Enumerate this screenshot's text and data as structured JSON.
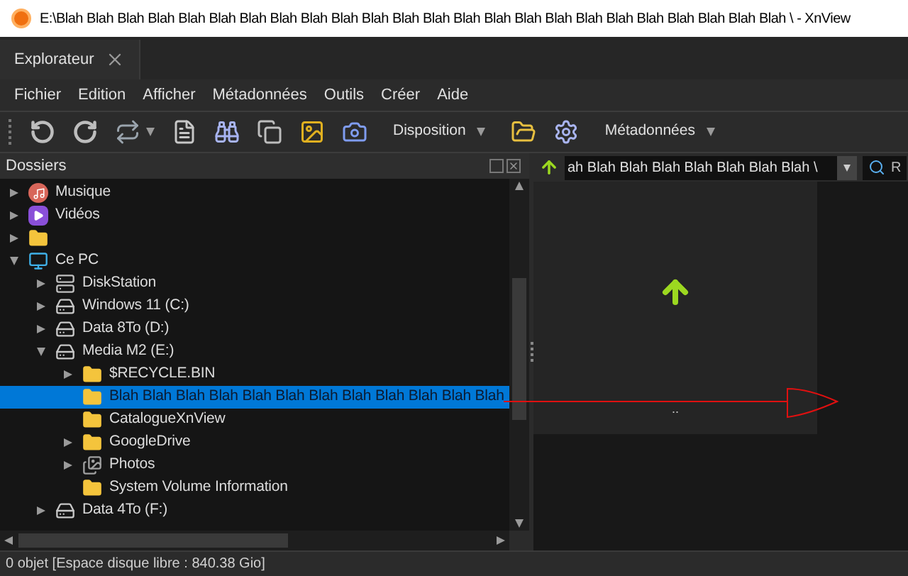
{
  "window": {
    "title": "E:\\Blah Blah Blah Blah Blah Blah Blah Blah Blah Blah Blah Blah Blah Blah Blah Blah Blah Blah Blah Blah Blah Blah Blah Blah \\ - XnView"
  },
  "tabs": [
    {
      "label": "Explorateur",
      "selected": true
    }
  ],
  "menu": [
    "Fichier",
    "Edition",
    "Afficher",
    "Métadonnées",
    "Outils",
    "Créer",
    "Aide"
  ],
  "toolbar": [
    {
      "kind": "rotate-left"
    },
    {
      "kind": "rotate-right"
    },
    {
      "kind": "transform"
    },
    {
      "kind": "info"
    },
    {
      "kind": "binoculars"
    },
    {
      "kind": "convert"
    },
    {
      "kind": "slideshow"
    },
    {
      "kind": "capture"
    },
    {
      "kind": "dropdown",
      "label": "Disposition"
    },
    {
      "kind": "folder-files"
    },
    {
      "kind": "gear"
    },
    {
      "kind": "dropdown",
      "label": "Métadonnées"
    }
  ],
  "folders_panel": {
    "title": "Dossiers",
    "tree": [
      {
        "kind": "music",
        "label": "Musique",
        "expanded": false,
        "selected": false
      },
      {
        "kind": "video",
        "label": "Vidéos",
        "expanded": false,
        "selected": false
      },
      {
        "kind": "folder",
        "expanded": false,
        "selected": false
      },
      {
        "kind": "pc",
        "label": "Ce PC",
        "expanded": true,
        "selected": false,
        "children": [
          {
            "kind": "nas",
            "label": "DiskStation",
            "expanded": false,
            "selected": false
          },
          {
            "kind": "drive",
            "label": "Windows 11 (C:)",
            "expanded": false,
            "selected": false
          },
          {
            "kind": "drive",
            "label": "Data 8To (D:)",
            "expanded": false,
            "selected": false
          },
          {
            "kind": "drive",
            "label": "Media M2 (E:)",
            "expanded": true,
            "selected": false,
            "children": [
              {
                "kind": "folder",
                "label": "$RECYCLE.BIN",
                "expanded": false,
                "selected": false
              },
              {
                "kind": "folder",
                "label": "Blah Blah Blah Blah Blah Blah Blah Blah Blah Blah Blah Blah",
                "selected": true
              },
              {
                "kind": "folder",
                "label": "CatalogueXnView",
                "selected": false
              },
              {
                "kind": "folder",
                "label": "GoogleDrive",
                "expanded": false,
                "selected": false
              },
              {
                "kind": "photos",
                "label": "Photos",
                "expanded": false,
                "selected": false
              },
              {
                "kind": "folder",
                "label": "System Volume Information",
                "selected": false
              }
            ]
          },
          {
            "kind": "drive",
            "label": "Data 4To (F:)",
            "expanded": false,
            "selected": false
          }
        ]
      }
    ]
  },
  "path_bar": {
    "value": "ah Blah Blah Blah Blah Blah Blah Blah \\"
  },
  "search": {
    "value": "R"
  },
  "browser": {
    "items": [
      {
        "label": ".."
      }
    ]
  },
  "status_bar": "0 objet [Espace disque libre : 840.38 Gio]"
}
